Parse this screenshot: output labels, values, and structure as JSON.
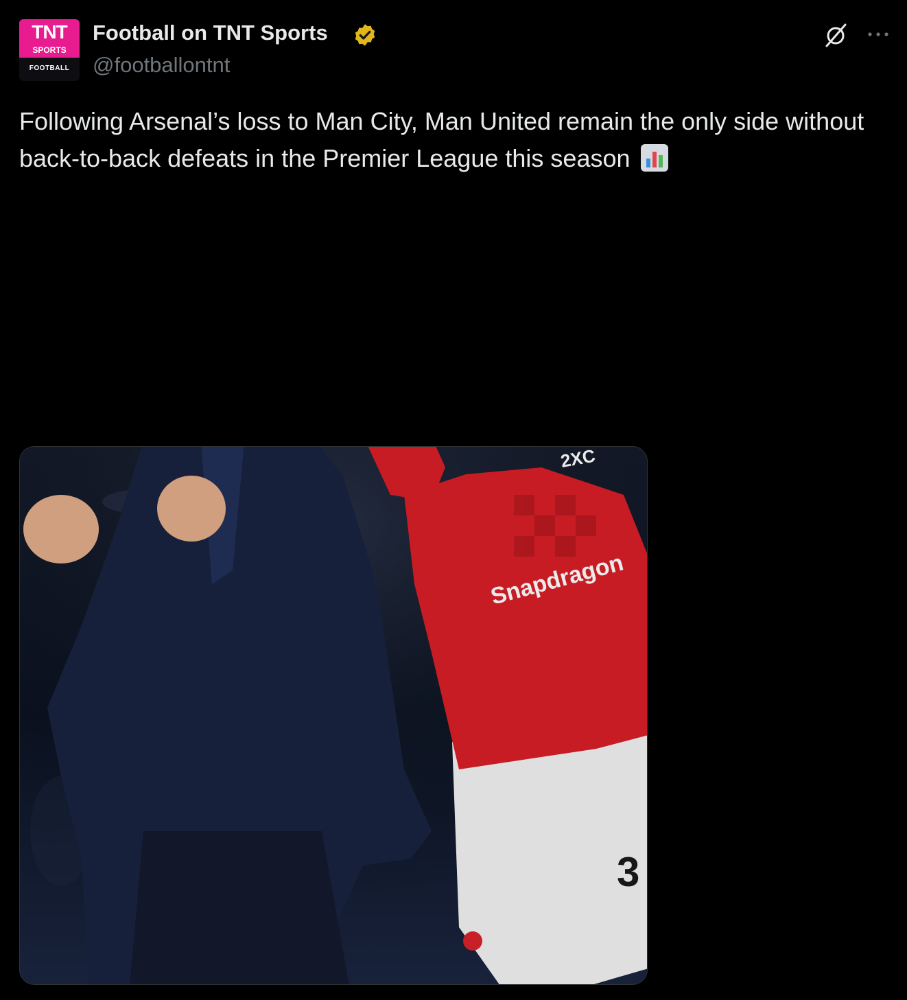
{
  "account": {
    "display_name": "Football on TNT Sports",
    "handle": "@footballontnt",
    "verified_badge": "gold-verified-icon",
    "avatar": {
      "line1": "TNT",
      "line2": "SPORTS",
      "line3": "FOOTBALL",
      "brand_color": "#e81c8f"
    }
  },
  "actions": {
    "grok_icon": "grok-icon",
    "more_icon": "more-horizontal-icon"
  },
  "tweet": {
    "text": "Following Arsenal’s loss to Man City, Man United remain the only side without back-to-back defeats in the Premier League this season",
    "emoji": "bar-chart-emoji"
  },
  "media": {
    "type": "photo",
    "jersey_sponsor": "Snapdragon",
    "shirt_number": "3",
    "shirt_badge": "2XC"
  },
  "colors": {
    "background": "#000000",
    "text": "#e7e9ea",
    "secondary_text": "#71767b",
    "verified_gold": "#e2b719"
  }
}
